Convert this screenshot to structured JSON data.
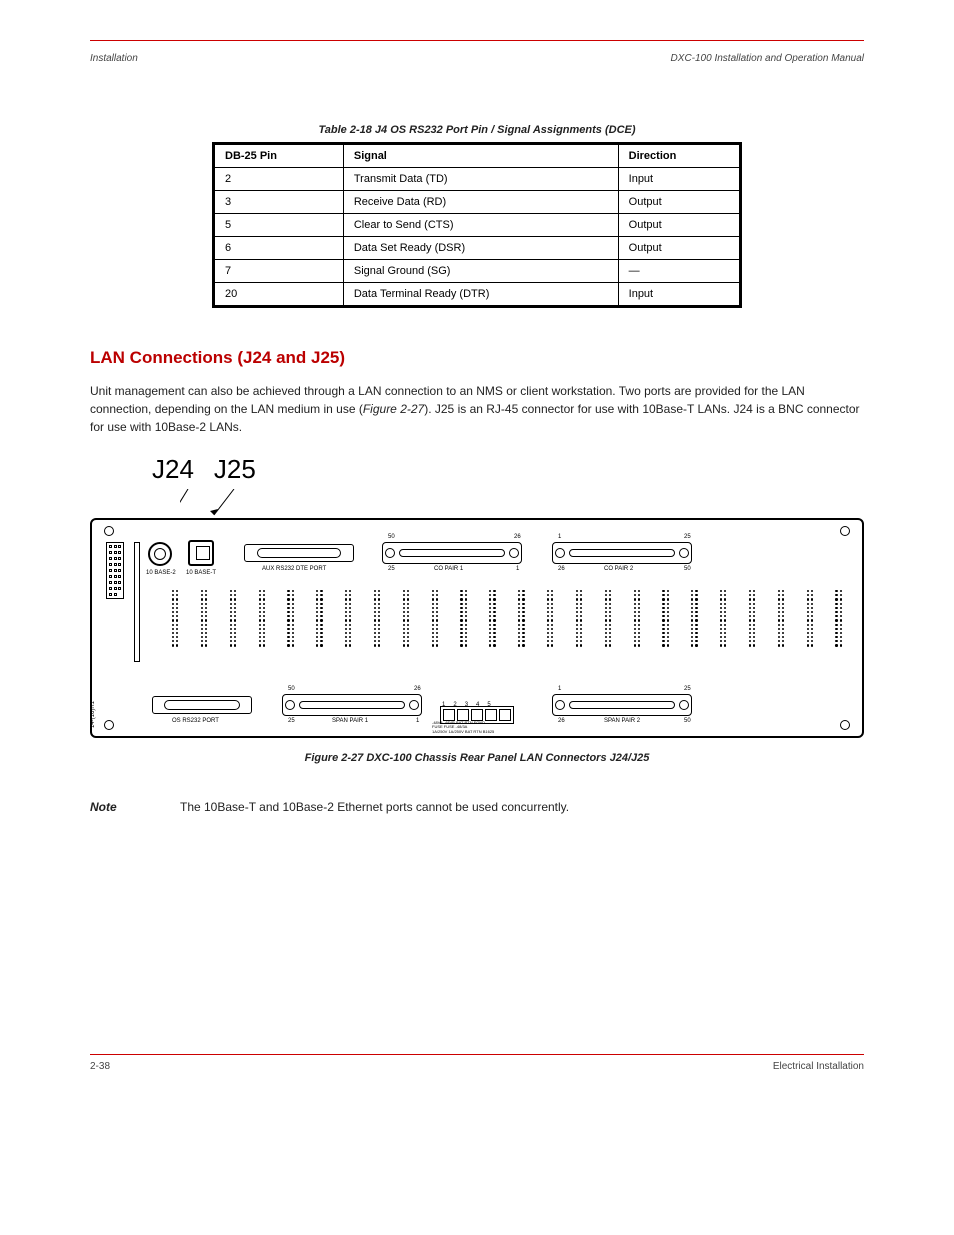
{
  "runningHeader": {
    "left": "Installation",
    "right": "DXC-100 Installation and Operation Manual"
  },
  "table": {
    "title": "Table 2-18  J4 OS RS232 Port Pin / Signal Assignments (DCE)",
    "headers": [
      "DB-25 Pin",
      "Signal",
      "Direction"
    ],
    "rows": [
      [
        "2",
        "Transmit Data (TD)",
        "Input"
      ],
      [
        "3",
        "Receive Data (RD)",
        "Output"
      ],
      [
        "5",
        "Clear to Send (CTS)",
        "Output"
      ],
      [
        "6",
        "Data Set Ready (DSR)",
        "Output"
      ],
      [
        "7",
        "Signal Ground (SG)",
        "—"
      ],
      [
        "20",
        "Data Terminal Ready (DTR)",
        "Input"
      ]
    ]
  },
  "section": {
    "heading": "LAN Connections (J24 and J25)",
    "paragraph": "Unit management can also be achieved through a LAN connection to an NMS or client workstation. Two ports are provided for the LAN connection, depending on the LAN medium in use ({fig}). J25 is an RJ-45 connector for use with 10Base-T LANs. J24 is a BNC connector for use with 10Base-2 LANs.",
    "figref": "Figure 2-27"
  },
  "figure": {
    "labels": [
      "J24",
      "J25"
    ],
    "caption": "Figure 2-27  DXC-100 Chassis Rear Panel LAN Connectors J24/J25",
    "connectors": {
      "base2": "10 BASE-2",
      "baseT": "10 BASE-T",
      "auxPort": "AUX RS232 DTE PORT",
      "osPort": "OS RS232 PORT",
      "coPair1": "CO PAIR 1",
      "coPair2": "CO PAIR 2",
      "spanPair1": "SPAN PAIR 1",
      "spanPair2": "SPAN PAIR 2",
      "fuseNumbers": [
        "1",
        "2",
        "3",
        "4",
        "5"
      ],
      "fuseLabels": "-48VA  -48VB  BAT  RTN    FGND",
      "fuseSub1": "FUSE  FUSE          -48/3A",
      "fuseSub2": "1A/250V  1A/250V  BAT  RTN  B1625",
      "pin50": "50",
      "pin26": "26",
      "pin25": "25",
      "pin1": "1",
      "sideRef": "14-(16)R1"
    }
  },
  "note": {
    "label": "Note",
    "text": "The 10Base-T and 10Base-2 Ethernet ports cannot be used concurrently."
  },
  "footer": {
    "left": "2-38",
    "right": "Electrical Installation"
  }
}
